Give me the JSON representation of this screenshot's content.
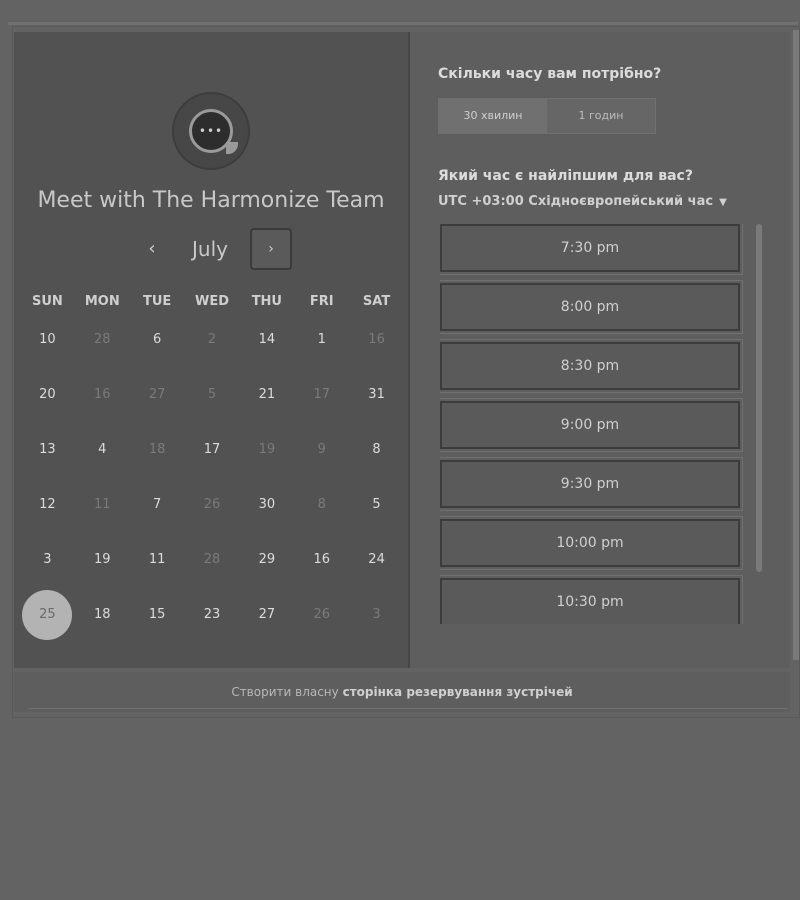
{
  "header": {
    "title": "Meet with The Harmonize Team"
  },
  "calendar": {
    "month": "July",
    "prev_label": "‹",
    "next_label": "›",
    "weekdays": [
      "SUN",
      "MON",
      "TUE",
      "WED",
      "THU",
      "FRI",
      "SAT"
    ],
    "days": [
      {
        "label": "10",
        "muted": false
      },
      {
        "label": "28",
        "muted": true
      },
      {
        "label": "6",
        "muted": false
      },
      {
        "label": "2",
        "muted": true
      },
      {
        "label": "14",
        "muted": false
      },
      {
        "label": "1",
        "muted": false
      },
      {
        "label": "16",
        "muted": true
      },
      {
        "label": "20",
        "muted": false
      },
      {
        "label": "16",
        "muted": true
      },
      {
        "label": "27",
        "muted": true
      },
      {
        "label": "5",
        "muted": true
      },
      {
        "label": "21",
        "muted": false
      },
      {
        "label": "17",
        "muted": true
      },
      {
        "label": "31",
        "muted": false
      },
      {
        "label": "13",
        "muted": false
      },
      {
        "label": "4",
        "muted": false
      },
      {
        "label": "18",
        "muted": true
      },
      {
        "label": "17",
        "muted": false
      },
      {
        "label": "19",
        "muted": true
      },
      {
        "label": "9",
        "muted": true
      },
      {
        "label": "8",
        "muted": false
      },
      {
        "label": "12",
        "muted": false
      },
      {
        "label": "11",
        "muted": true
      },
      {
        "label": "7",
        "muted": false
      },
      {
        "label": "26",
        "muted": true
      },
      {
        "label": "30",
        "muted": false
      },
      {
        "label": "8",
        "muted": true
      },
      {
        "label": "5",
        "muted": false
      },
      {
        "label": "3",
        "muted": false
      },
      {
        "label": "19",
        "muted": false
      },
      {
        "label": "11",
        "muted": false
      },
      {
        "label": "28",
        "muted": true
      },
      {
        "label": "29",
        "muted": false
      },
      {
        "label": "16",
        "muted": false
      },
      {
        "label": "24",
        "muted": false
      },
      {
        "label": "25",
        "muted": false,
        "selected": true
      },
      {
        "label": "18",
        "muted": false
      },
      {
        "label": "15",
        "muted": false
      },
      {
        "label": "23",
        "muted": false
      },
      {
        "label": "27",
        "muted": false
      },
      {
        "label": "26",
        "muted": true
      },
      {
        "label": "3",
        "muted": true
      }
    ]
  },
  "booking": {
    "duration_question": "Скільки часу вам потрібно?",
    "durations": [
      {
        "label": "30 хвилин",
        "active": true
      },
      {
        "label": "1 годин",
        "active": false
      }
    ],
    "time_question": "Який час є найліпшим для вас?",
    "timezone": "UTC +03:00 Східноєвропейський час",
    "slots": [
      "7:30 pm",
      "8:00 pm",
      "8:30 pm",
      "9:00 pm",
      "9:30 pm",
      "10:00 pm",
      "10:30 pm"
    ]
  },
  "footer": {
    "prefix": "Створити власну",
    "link": "сторінка резервування зустрічей"
  }
}
